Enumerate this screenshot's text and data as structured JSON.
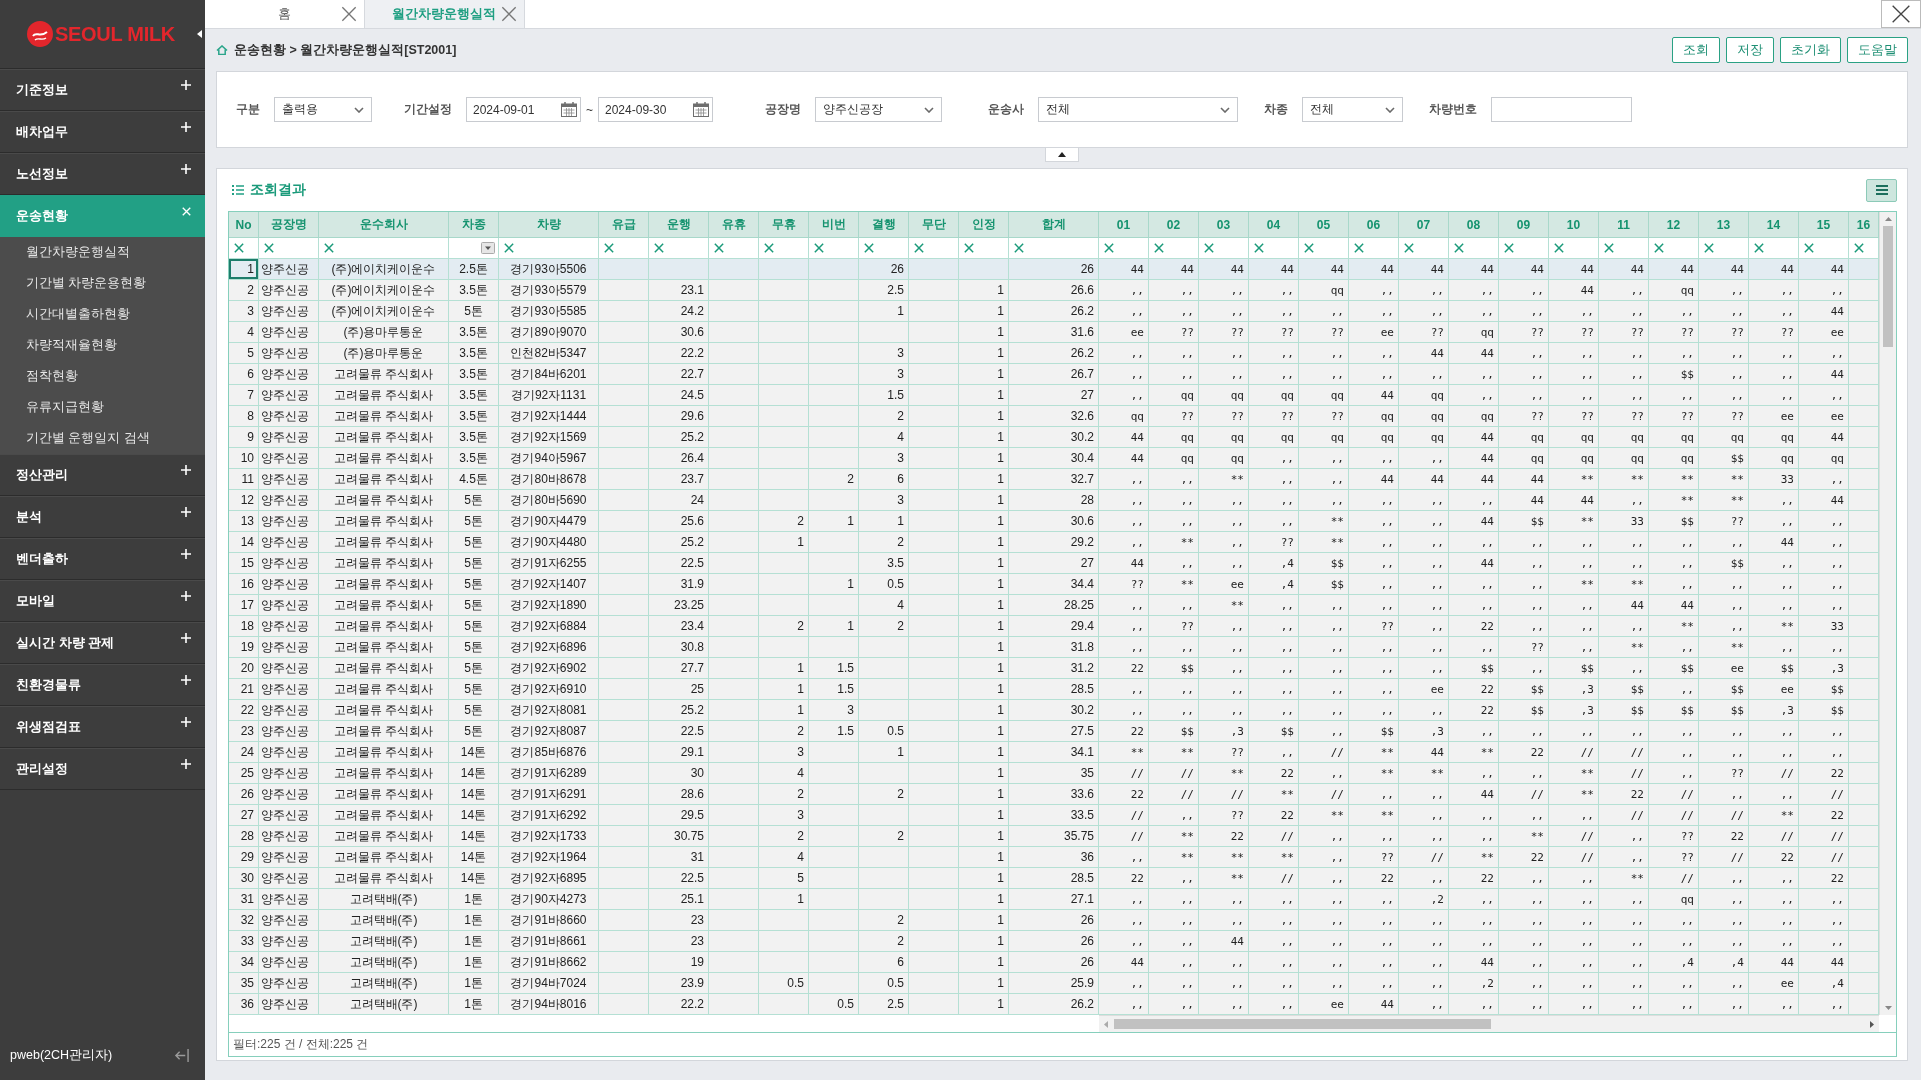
{
  "sidebar": {
    "logo": "SEOUL MILK",
    "menu": [
      {
        "label": "기준정보",
        "expanded": false
      },
      {
        "label": "배차업무",
        "expanded": false
      },
      {
        "label": "노선정보",
        "expanded": false
      },
      {
        "label": "운송현황",
        "expanded": true,
        "children": [
          "월간차량운행실적",
          "기간별 차량운용현황",
          "시간대별출하현황",
          "차량적재율현황",
          "점착현황",
          "유류지급현황",
          "기간별 운행일지 검색"
        ]
      },
      {
        "label": "정산관리",
        "expanded": false
      },
      {
        "label": "분석",
        "expanded": false
      },
      {
        "label": "벤더출하",
        "expanded": false
      },
      {
        "label": "모바일",
        "expanded": false
      },
      {
        "label": "실시간 차량 관제",
        "expanded": false
      },
      {
        "label": "친환경물류",
        "expanded": false
      },
      {
        "label": "위생점검표",
        "expanded": false
      },
      {
        "label": "관리설정",
        "expanded": false
      }
    ],
    "user": "pweb(2CH관리자)"
  },
  "tabs": [
    {
      "label": "홈",
      "selected": false
    },
    {
      "label": "월간차량운행실적",
      "selected": true
    }
  ],
  "breadcrumb": "운송현황 > 월간차량운행실적[ST2001]",
  "buttons": [
    "조회",
    "저장",
    "초기화",
    "도움말"
  ],
  "filters": [
    {
      "label": "구분",
      "kind": "select",
      "value": "출력용"
    },
    {
      "label": "기간설정",
      "kind": "daterange",
      "from": "2024-09-01",
      "separator": "~",
      "to": "2024-09-30"
    },
    {
      "label": "공장명",
      "kind": "select",
      "value": "양주신공장"
    },
    {
      "label": "운송사",
      "kind": "select",
      "value": "전체"
    },
    {
      "label": "차종",
      "kind": "select",
      "value": "전체"
    },
    {
      "label": "차량번호",
      "kind": "input"
    }
  ],
  "results": {
    "title": "조회결과",
    "table": {
      "columns": [
        {
          "label": "No",
          "kind": "clear"
        },
        {
          "label": "공장명",
          "kind": "clear"
        },
        {
          "label": "운수회사",
          "kind": "clear"
        },
        {
          "label": "차종",
          "kind": "select"
        },
        {
          "label": "차량",
          "kind": "clear"
        },
        {
          "label": "유급",
          "kind": "clear"
        },
        {
          "label": "운행",
          "kind": "clear"
        },
        {
          "label": "유휴",
          "kind": "clear"
        },
        {
          "label": "무휴",
          "kind": "clear"
        },
        {
          "label": "비번",
          "kind": "clear"
        },
        {
          "label": "결행",
          "kind": "clear"
        },
        {
          "label": "무단",
          "kind": "clear"
        },
        {
          "label": "인정",
          "kind": "clear"
        },
        {
          "label": "합계",
          "kind": "clear"
        },
        {
          "label": "01",
          "kind": "clear"
        },
        {
          "label": "02",
          "kind": "clear"
        },
        {
          "label": "03",
          "kind": "clear"
        },
        {
          "label": "04",
          "kind": "clear"
        },
        {
          "label": "05",
          "kind": "clear"
        },
        {
          "label": "06",
          "kind": "clear"
        },
        {
          "label": "07",
          "kind": "clear"
        },
        {
          "label": "08",
          "kind": "clear"
        },
        {
          "label": "09",
          "kind": "clear"
        },
        {
          "label": "10",
          "kind": "clear"
        },
        {
          "label": "11",
          "kind": "clear"
        },
        {
          "label": "12",
          "kind": "clear"
        },
        {
          "label": "13",
          "kind": "clear"
        },
        {
          "label": "14",
          "kind": "clear"
        },
        {
          "label": "15",
          "kind": "clear"
        },
        {
          "label": "16",
          "kind": "clear"
        }
      ],
      "rows": [
        {
          "selected": true,
          "cells": [
            "1",
            "양주신공",
            "(주)에이치케이운수",
            "2.5톤",
            "경기93아5506",
            null,
            null,
            null,
            null,
            null,
            "26",
            null,
            null,
            "26",
            "44",
            "44",
            "44",
            "44",
            "44",
            "44",
            "44",
            "44",
            "44",
            "44",
            "44",
            "44",
            "44",
            "44",
            "44"
          ]
        },
        {
          "selected": false,
          "cells": [
            "2",
            "양주신공",
            "(주)에이치케이운수",
            "3.5톤",
            "경기93아5579",
            null,
            "23.1",
            null,
            null,
            null,
            "2.5",
            null,
            "1",
            "26.6",
            ",,",
            ",,",
            ",,",
            ",,",
            "qq",
            ",,",
            ",,",
            ",,",
            ",,",
            "44",
            ",,",
            "qq",
            ",,",
            ",,",
            ",,"
          ]
        },
        {
          "selected": false,
          "cells": [
            "3",
            "양주신공",
            "(주)에이치케이운수",
            "5톤",
            "경기93아5585",
            null,
            "24.2",
            null,
            null,
            null,
            "1",
            null,
            "1",
            "26.2",
            ",,",
            ",,",
            ",,",
            ",,",
            ",,",
            ",,",
            ",,",
            ",,",
            ",,",
            ",,",
            ",,",
            ",,",
            ",,",
            ",,",
            "44"
          ]
        },
        {
          "selected": false,
          "cells": [
            "4",
            "양주신공",
            "(주)용마루통운",
            "3.5톤",
            "경기89아9070",
            null,
            "30.6",
            null,
            null,
            null,
            null,
            null,
            "1",
            "31.6",
            "ee",
            "??",
            "??",
            "??",
            "??",
            "ee",
            "??",
            "qq",
            "??",
            "??",
            "??",
            "??",
            "??",
            "??",
            "ee"
          ]
        },
        {
          "selected": false,
          "cells": [
            "5",
            "양주신공",
            "(주)용마루통운",
            "3.5톤",
            "인천82바5347",
            null,
            "22.2",
            null,
            null,
            null,
            "3",
            null,
            "1",
            "26.2",
            ",,",
            ",,",
            ",,",
            ",,",
            ",,",
            ",,",
            "44",
            "44",
            ",,",
            ",,",
            ",,",
            ",,",
            ",,",
            ",,",
            ",,"
          ]
        },
        {
          "selected": false,
          "cells": [
            "6",
            "양주신공",
            "고려물류 주식회사",
            "3.5톤",
            "경기84바6201",
            null,
            "22.7",
            null,
            null,
            null,
            "3",
            null,
            "1",
            "26.7",
            ",,",
            ",,",
            ",,",
            ",,",
            ",,",
            ",,",
            ",,",
            ",,",
            ",,",
            ",,",
            ",,",
            "$$",
            ",,",
            ",,",
            "44"
          ]
        },
        {
          "selected": false,
          "cells": [
            "7",
            "양주신공",
            "고려물류 주식회사",
            "3.5톤",
            "경기92자1131",
            null,
            "24.5",
            null,
            null,
            null,
            "1.5",
            null,
            "1",
            "27",
            ",,",
            "qq",
            "qq",
            "qq",
            "qq",
            "44",
            "qq",
            ",,",
            ",,",
            ",,",
            ",,",
            ",,",
            ",,",
            ",,",
            ",,"
          ]
        },
        {
          "selected": false,
          "cells": [
            "8",
            "양주신공",
            "고려물류 주식회사",
            "3.5톤",
            "경기92자1444",
            null,
            "29.6",
            null,
            null,
            null,
            "2",
            null,
            "1",
            "32.6",
            "qq",
            "??",
            "??",
            "??",
            "??",
            "qq",
            "qq",
            "qq",
            "??",
            "??",
            "??",
            "??",
            "??",
            "ee",
            "ee"
          ]
        },
        {
          "selected": false,
          "cells": [
            "9",
            "양주신공",
            "고려물류 주식회사",
            "3.5톤",
            "경기92자1569",
            null,
            "25.2",
            null,
            null,
            null,
            "4",
            null,
            "1",
            "30.2",
            "44",
            "qq",
            "qq",
            "qq",
            "qq",
            "qq",
            "qq",
            "44",
            "qq",
            "qq",
            "qq",
            "qq",
            "qq",
            "qq",
            "44"
          ]
        },
        {
          "selected": false,
          "cells": [
            "10",
            "양주신공",
            "고려물류 주식회사",
            "3.5톤",
            "경기94아5967",
            null,
            "26.4",
            null,
            null,
            null,
            "3",
            null,
            "1",
            "30.4",
            "44",
            "qq",
            "qq",
            ",,",
            ",,",
            ",,",
            ",,",
            "44",
            "qq",
            "qq",
            "qq",
            "qq",
            "$$",
            "qq",
            "qq"
          ]
        },
        {
          "selected": false,
          "cells": [
            "11",
            "양주신공",
            "고려물류 주식회사",
            "4.5톤",
            "경기80바8678",
            null,
            "23.7",
            null,
            null,
            "2",
            "6",
            null,
            "1",
            "32.7",
            ",,",
            ",,",
            "**",
            ",,",
            ",,",
            "44",
            "44",
            "44",
            "44",
            "**",
            "**",
            "**",
            "**",
            "33",
            ",,"
          ]
        },
        {
          "selected": false,
          "cells": [
            "12",
            "양주신공",
            "고려물류 주식회사",
            "5톤",
            "경기80바5690",
            null,
            "24",
            null,
            null,
            null,
            "3",
            null,
            "1",
            "28",
            ",,",
            ",,",
            ",,",
            ",,",
            ",,",
            ",,",
            ",,",
            ",,",
            "44",
            "44",
            ",,",
            "**",
            "**",
            ",,",
            "44"
          ]
        },
        {
          "selected": false,
          "cells": [
            "13",
            "양주신공",
            "고려물류 주식회사",
            "5톤",
            "경기90자4479",
            null,
            "25.6",
            null,
            "2",
            "1",
            "1",
            null,
            "1",
            "30.6",
            ",,",
            ",,",
            ",,",
            ",,",
            "**",
            ",,",
            ",,",
            "44",
            "$$",
            "**",
            "33",
            "$$",
            "??",
            ",,",
            ",,"
          ]
        },
        {
          "selected": false,
          "cells": [
            "14",
            "양주신공",
            "고려물류 주식회사",
            "5톤",
            "경기90자4480",
            null,
            "25.2",
            null,
            "1",
            null,
            "2",
            null,
            "1",
            "29.2",
            ",,",
            "**",
            ",,",
            "??",
            "**",
            ",,",
            ",,",
            ",,",
            ",,",
            ",,",
            ",,",
            ",,",
            ",,",
            "44",
            ",,"
          ]
        },
        {
          "selected": false,
          "cells": [
            "15",
            "양주신공",
            "고려물류 주식회사",
            "5톤",
            "경기91자6255",
            null,
            "22.5",
            null,
            null,
            null,
            "3.5",
            null,
            "1",
            "27",
            "44",
            ",,",
            ",,",
            ",4",
            "$$",
            ",,",
            ",,",
            "44",
            ",,",
            ",,",
            ",,",
            ",,",
            "$$",
            ",,",
            ",,"
          ]
        },
        {
          "selected": false,
          "cells": [
            "16",
            "양주신공",
            "고려물류 주식회사",
            "5톤",
            "경기92자1407",
            null,
            "31.9",
            null,
            null,
            "1",
            "0.5",
            null,
            "1",
            "34.4",
            "??",
            "**",
            "ee",
            ",4",
            "$$",
            ",,",
            ",,",
            ",,",
            ",,",
            "**",
            "**",
            ",,",
            ",,",
            ",,",
            ",,"
          ]
        },
        {
          "selected": false,
          "cells": [
            "17",
            "양주신공",
            "고려물류 주식회사",
            "5톤",
            "경기92자1890",
            null,
            "23.25",
            null,
            null,
            null,
            "4",
            null,
            "1",
            "28.25",
            ",,",
            ",,",
            "**",
            ",,",
            ",,",
            ",,",
            ",,",
            ",,",
            ",,",
            ",,",
            "44",
            "44",
            ",,",
            ",,",
            ",,"
          ]
        },
        {
          "selected": false,
          "cells": [
            "18",
            "양주신공",
            "고려물류 주식회사",
            "5톤",
            "경기92자6884",
            null,
            "23.4",
            null,
            "2",
            "1",
            "2",
            null,
            "1",
            "29.4",
            ",,",
            "??",
            ",,",
            ",,",
            ",,",
            "??",
            ",,",
            "22",
            ",,",
            ",,",
            ",,",
            "**",
            ",,",
            "**",
            "33"
          ]
        },
        {
          "selected": false,
          "cells": [
            "19",
            "양주신공",
            "고려물류 주식회사",
            "5톤",
            "경기92자6896",
            null,
            "30.8",
            null,
            null,
            null,
            null,
            null,
            "1",
            "31.8",
            ",,",
            ",,",
            ",,",
            ",,",
            ",,",
            ",,",
            ",,",
            ",,",
            "??",
            ",,",
            "**",
            ",,",
            "**",
            ",,",
            ",,"
          ]
        },
        {
          "selected": false,
          "cells": [
            "20",
            "양주신공",
            "고려물류 주식회사",
            "5톤",
            "경기92자6902",
            null,
            "27.7",
            null,
            "1",
            "1.5",
            null,
            null,
            "1",
            "31.2",
            "22",
            "$$",
            ",,",
            ",,",
            ",,",
            ",,",
            ",,",
            "$$",
            ",,",
            "$$",
            ",,",
            "$$",
            "ee",
            "$$",
            ",3"
          ]
        },
        {
          "selected": false,
          "cells": [
            "21",
            "양주신공",
            "고려물류 주식회사",
            "5톤",
            "경기92자6910",
            null,
            "25",
            null,
            "1",
            "1.5",
            null,
            null,
            "1",
            "28.5",
            ",,",
            ",,",
            ",,",
            ",,",
            ",,",
            ",,",
            "ee",
            "22",
            "$$",
            ",3",
            "$$",
            ",,",
            "$$",
            "ee",
            "$$"
          ]
        },
        {
          "selected": false,
          "cells": [
            "22",
            "양주신공",
            "고려물류 주식회사",
            "5톤",
            "경기92자8081",
            null,
            "25.2",
            null,
            "1",
            "3",
            null,
            null,
            "1",
            "30.2",
            ",,",
            ",,",
            ",,",
            ",,",
            ",,",
            ",,",
            ",,",
            "22",
            "$$",
            ",3",
            "$$",
            "$$",
            "$$",
            ",3",
            "$$"
          ]
        },
        {
          "selected": false,
          "cells": [
            "23",
            "양주신공",
            "고려물류 주식회사",
            "5톤",
            "경기92자8087",
            null,
            "22.5",
            null,
            "2",
            "1.5",
            "0.5",
            null,
            "1",
            "27.5",
            "22",
            "$$",
            ",3",
            "$$",
            ",,",
            "$$",
            ",3",
            ",,",
            ",,",
            ",,",
            ",,",
            ",,",
            ",,",
            ",,",
            ",,"
          ]
        },
        {
          "selected": false,
          "cells": [
            "24",
            "양주신공",
            "고려물류 주식회사",
            "14톤",
            "경기85바6876",
            null,
            "29.1",
            null,
            "3",
            null,
            "1",
            null,
            "1",
            "34.1",
            "**",
            "**",
            "??",
            ",,",
            "//",
            "**",
            "44",
            "**",
            "22",
            "//",
            "//",
            ",,",
            ",,",
            ",,",
            ",,"
          ]
        },
        {
          "selected": false,
          "cells": [
            "25",
            "양주신공",
            "고려물류 주식회사",
            "14톤",
            "경기91자6289",
            null,
            "30",
            null,
            "4",
            null,
            null,
            null,
            "1",
            "35",
            "//",
            "//",
            "**",
            "22",
            ",,",
            "**",
            "**",
            ",,",
            ",,",
            "**",
            "//",
            ",,",
            "??",
            "//",
            "22"
          ]
        },
        {
          "selected": false,
          "cells": [
            "26",
            "양주신공",
            "고려물류 주식회사",
            "14톤",
            "경기91자6291",
            null,
            "28.6",
            null,
            "2",
            null,
            "2",
            null,
            "1",
            "33.6",
            "22",
            "//",
            "//",
            "**",
            "//",
            ",,",
            ",,",
            "44",
            "//",
            "**",
            "22",
            "//",
            ",,",
            ",,",
            "//"
          ]
        },
        {
          "selected": false,
          "cells": [
            "27",
            "양주신공",
            "고려물류 주식회사",
            "14톤",
            "경기91자6292",
            null,
            "29.5",
            null,
            "3",
            null,
            null,
            null,
            "1",
            "33.5",
            "//",
            ",,",
            "??",
            "22",
            "**",
            "**",
            ",,",
            ",,",
            ",,",
            ",,",
            "//",
            "//",
            "//",
            "**",
            "22"
          ]
        },
        {
          "selected": false,
          "cells": [
            "28",
            "양주신공",
            "고려물류 주식회사",
            "14톤",
            "경기92자1733",
            null,
            "30.75",
            null,
            "2",
            null,
            "2",
            null,
            "1",
            "35.75",
            "//",
            "**",
            "22",
            "//",
            ",,",
            ",,",
            ",,",
            ",,",
            "**",
            "//",
            ",,",
            "??",
            "22",
            "//",
            "//"
          ]
        },
        {
          "selected": false,
          "cells": [
            "29",
            "양주신공",
            "고려물류 주식회사",
            "14톤",
            "경기92자1964",
            null,
            "31",
            null,
            "4",
            null,
            null,
            null,
            "1",
            "36",
            ",,",
            "**",
            "**",
            "**",
            ",,",
            "??",
            "//",
            "**",
            "22",
            "//",
            ",,",
            "??",
            "//",
            "22",
            "//"
          ]
        },
        {
          "selected": false,
          "cells": [
            "30",
            "양주신공",
            "고려물류 주식회사",
            "14톤",
            "경기92자6895",
            null,
            "22.5",
            null,
            "5",
            null,
            null,
            null,
            "1",
            "28.5",
            "22",
            ",,",
            "**",
            "//",
            ",,",
            "22",
            ",,",
            "22",
            ",,",
            ",,",
            "**",
            "//",
            ",,",
            ",,",
            "22"
          ]
        },
        {
          "selected": false,
          "cells": [
            "31",
            "양주신공",
            "고려택배(주)",
            "1톤",
            "경기90자4273",
            null,
            "25.1",
            null,
            "1",
            null,
            null,
            null,
            "1",
            "27.1",
            ",,",
            ",,",
            ",,",
            ",,",
            ",,",
            ",,",
            ",2",
            ",,",
            ",,",
            ",,",
            ",,",
            "qq",
            ",,",
            ",,",
            ",,"
          ]
        },
        {
          "selected": false,
          "cells": [
            "32",
            "양주신공",
            "고려택배(주)",
            "1톤",
            "경기91바8660",
            null,
            "23",
            null,
            null,
            null,
            "2",
            null,
            "1",
            "26",
            ",,",
            ",,",
            ",,",
            ",,",
            ",,",
            ",,",
            ",,",
            ",,",
            ",,",
            ",,",
            ",,",
            ",,",
            ",,",
            ",,",
            ",,"
          ]
        },
        {
          "selected": false,
          "cells": [
            "33",
            "양주신공",
            "고려택배(주)",
            "1톤",
            "경기91바8661",
            null,
            "23",
            null,
            null,
            null,
            "2",
            null,
            "1",
            "26",
            ",,",
            ",,",
            "44",
            ",,",
            ",,",
            ",,",
            ",,",
            ",,",
            ",,",
            ",,",
            ",,",
            ",,",
            ",,",
            ",,",
            ",,"
          ]
        },
        {
          "selected": false,
          "cells": [
            "34",
            "양주신공",
            "고려택배(주)",
            "1톤",
            "경기91바8662",
            null,
            "19",
            null,
            null,
            null,
            "6",
            null,
            "1",
            "26",
            "44",
            ",,",
            ",,",
            ",,",
            ",,",
            ",,",
            ",,",
            "44",
            ",,",
            ",,",
            ",,",
            ",4",
            ",4",
            "44",
            "44"
          ]
        },
        {
          "selected": false,
          "cells": [
            "35",
            "양주신공",
            "고려택배(주)",
            "1톤",
            "경기94바7024",
            null,
            "23.9",
            null,
            "0.5",
            null,
            "0.5",
            null,
            "1",
            "25.9",
            ",,",
            ",,",
            ",,",
            ",,",
            ",,",
            ",,",
            ",,",
            ",2",
            ",,",
            ",,",
            ",,",
            ",,",
            ",,",
            "ee",
            ",4"
          ]
        },
        {
          "selected": false,
          "cells": [
            "36",
            "양주신공",
            "고려택배(주)",
            "1톤",
            "경기94바8016",
            null,
            "22.2",
            null,
            null,
            "0.5",
            "2.5",
            null,
            "1",
            "26.2",
            ",,",
            ",,",
            ",,",
            ",,",
            "ee",
            "44",
            ",,",
            ",,",
            ",,",
            ",,",
            ",,",
            ",,",
            ",,",
            ",,",
            ",,"
          ]
        }
      ]
    },
    "footer": "필터:225 건 / 전체:225 건"
  }
}
